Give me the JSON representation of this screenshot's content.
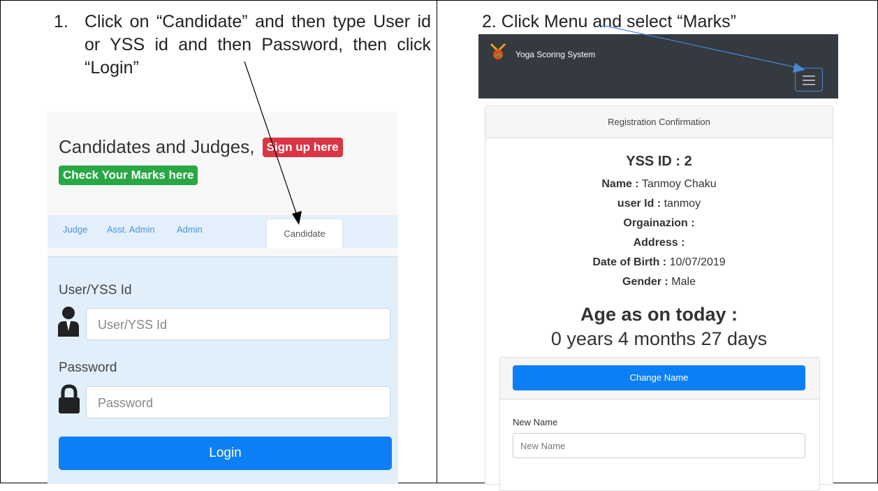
{
  "step1": {
    "number": "1.",
    "text": "Click on “Candidate” and then type User id or YSS id and then Password, then click “Login”"
  },
  "step2": {
    "text": "2.  Click Menu and select “Marks”"
  },
  "login_panel": {
    "heading": "Candidates and Judges,",
    "signup_badge": "Sign up here",
    "marks_badge": "Check Your Marks here",
    "tabs": [
      "Judge",
      "Asst. Admin",
      "Admin",
      "Candidate"
    ],
    "active_tab": "Candidate",
    "user_label": "User/YSS Id",
    "user_placeholder": "User/YSS Id",
    "password_label": "Password",
    "password_placeholder": "Password",
    "login_button": "Login"
  },
  "app": {
    "brand": "Yoga Scoring System",
    "menu_icon": "hamburger-icon",
    "card_title": "Registration Confirmation",
    "yss_id": "YSS ID : 2",
    "fields": [
      {
        "label": "Name :",
        "value": "Tanmoy Chaku"
      },
      {
        "label": "user Id :",
        "value": "tanmoy"
      },
      {
        "label": "Orgainazion :",
        "value": ""
      },
      {
        "label": "Address :",
        "value": ""
      },
      {
        "label": "Date of Birth :",
        "value": "10/07/2019"
      },
      {
        "label": "Gender :",
        "value": "Male"
      }
    ],
    "age_heading": "Age as on today :",
    "age_value": "0 years 4 months 27 days",
    "change_name_button": "Change Name",
    "new_name_label": "New Name",
    "new_name_placeholder": "New Name"
  },
  "colors": {
    "primary": "#0d7ff5",
    "danger": "#dc3545",
    "success": "#28a745",
    "navbar": "#343a40",
    "arrow": "#4a89d6"
  }
}
